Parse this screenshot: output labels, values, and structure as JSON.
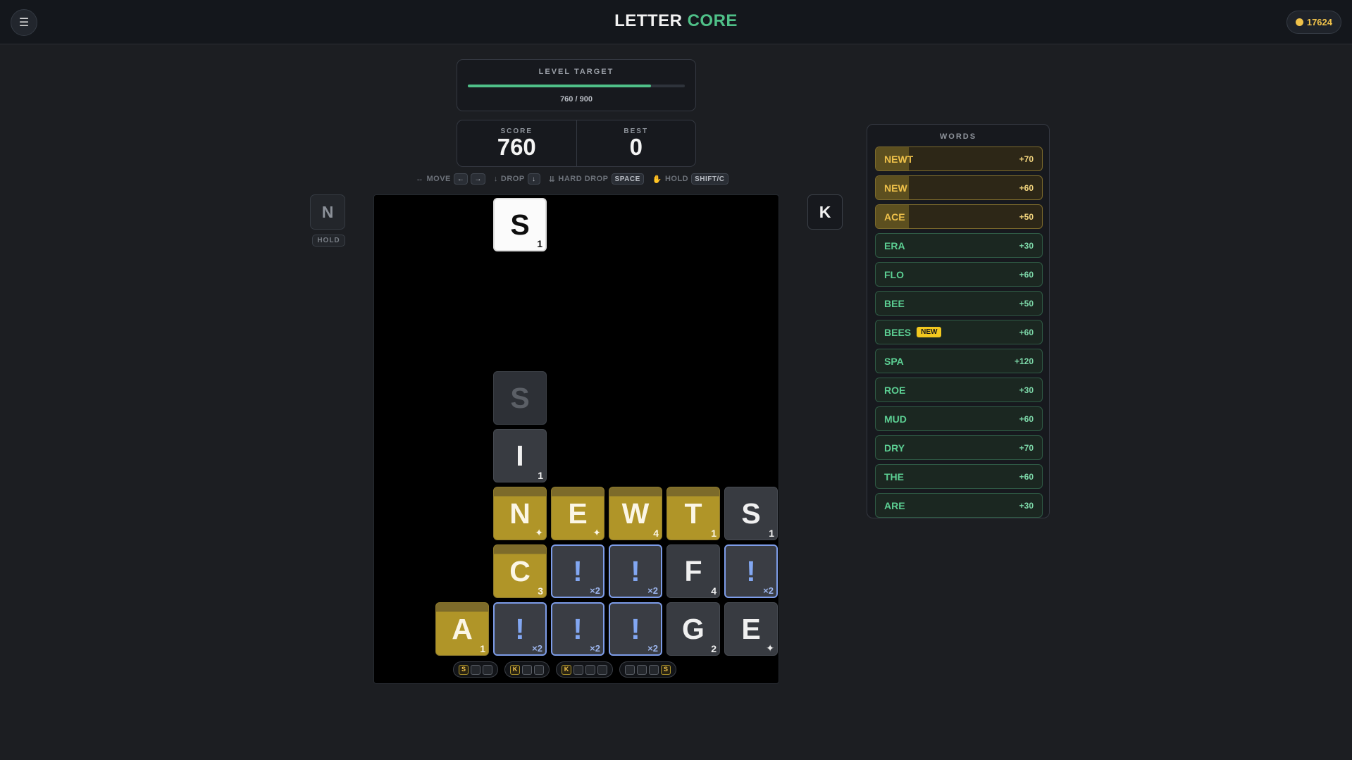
{
  "app": {
    "title_main": "LETTER",
    "title_accent": "CORE",
    "menu_icon": "☰",
    "coins": "17624"
  },
  "level": {
    "title": "LEVEL TARGET",
    "progress_text": "760 / 900",
    "progress_fraction": 0.844
  },
  "score": {
    "score_label": "SCORE",
    "score_value": "760",
    "best_label": "BEST",
    "best_value": "0"
  },
  "controls": {
    "move_icon": "↔",
    "move_label": "MOVE",
    "left_key": "←",
    "right_key": "→",
    "drop_icon": "↓",
    "drop_label": "DROP",
    "drop_key": "↓",
    "hard_drop_icon": "⇊",
    "hard_drop_label": "HARD DROP",
    "hard_drop_key": "SPACE",
    "hold_icon": "✋",
    "hold_label": "HOLD",
    "hold_key": "SHIFT/C"
  },
  "hold": {
    "letter": "N",
    "label": "HOLD"
  },
  "next": {
    "letter": "K"
  },
  "board": {
    "falling": {
      "letter": "S",
      "value": "1"
    },
    "ghost": {
      "letter": "S"
    },
    "tiles": [
      {
        "letter": "I",
        "value": "1",
        "style": "gray"
      },
      {
        "letter": "N",
        "value": "✦",
        "style": "gold"
      },
      {
        "letter": "E",
        "value": "✦",
        "style": "gold"
      },
      {
        "letter": "W",
        "value": "4",
        "style": "gold"
      },
      {
        "letter": "T",
        "value": "1",
        "style": "gold"
      },
      {
        "letter": "S",
        "value": "1",
        "style": "gray"
      },
      {
        "letter": "C",
        "value": "3",
        "style": "gold"
      },
      {
        "letter": "!",
        "value": "×2",
        "style": "blue"
      },
      {
        "letter": "!",
        "value": "×2",
        "style": "blue"
      },
      {
        "letter": "F",
        "value": "4",
        "style": "gray"
      },
      {
        "letter": "!",
        "value": "×2",
        "style": "blue"
      },
      {
        "letter": "A",
        "value": "1",
        "style": "gold"
      },
      {
        "letter": "!",
        "value": "×2",
        "style": "blue"
      },
      {
        "letter": "!",
        "value": "×2",
        "style": "blue"
      },
      {
        "letter": "!",
        "value": "×2",
        "style": "blue"
      },
      {
        "letter": "G",
        "value": "2",
        "style": "gray"
      },
      {
        "letter": "E",
        "value": "✦",
        "style": "gray"
      }
    ]
  },
  "patterns": [
    [
      "S",
      "_",
      "_"
    ],
    [
      "K",
      "_",
      "_"
    ],
    [
      "K",
      "_",
      "_",
      "_"
    ],
    [
      "_",
      "_",
      "_",
      "S"
    ]
  ],
  "words": {
    "title": "WORDS",
    "items": [
      {
        "word": "NEWT",
        "points": "+70",
        "style": "gold",
        "progress": 0.2
      },
      {
        "word": "NEW",
        "points": "+60",
        "style": "gold",
        "progress": 0.2
      },
      {
        "word": "ACE",
        "points": "+50",
        "style": "gold",
        "progress": 0.2
      },
      {
        "word": "ERA",
        "points": "+30",
        "style": "green"
      },
      {
        "word": "FLO",
        "points": "+60",
        "style": "green"
      },
      {
        "word": "BEE",
        "points": "+50",
        "style": "green"
      },
      {
        "word": "BEES",
        "points": "+60",
        "style": "green",
        "badge": "NEW"
      },
      {
        "word": "SPA",
        "points": "+120",
        "style": "green"
      },
      {
        "word": "ROE",
        "points": "+30",
        "style": "green"
      },
      {
        "word": "MUD",
        "points": "+60",
        "style": "green"
      },
      {
        "word": "DRY",
        "points": "+70",
        "style": "green"
      },
      {
        "word": "THE",
        "points": "+60",
        "style": "green"
      },
      {
        "word": "ARE",
        "points": "+30",
        "style": "green"
      }
    ]
  }
}
